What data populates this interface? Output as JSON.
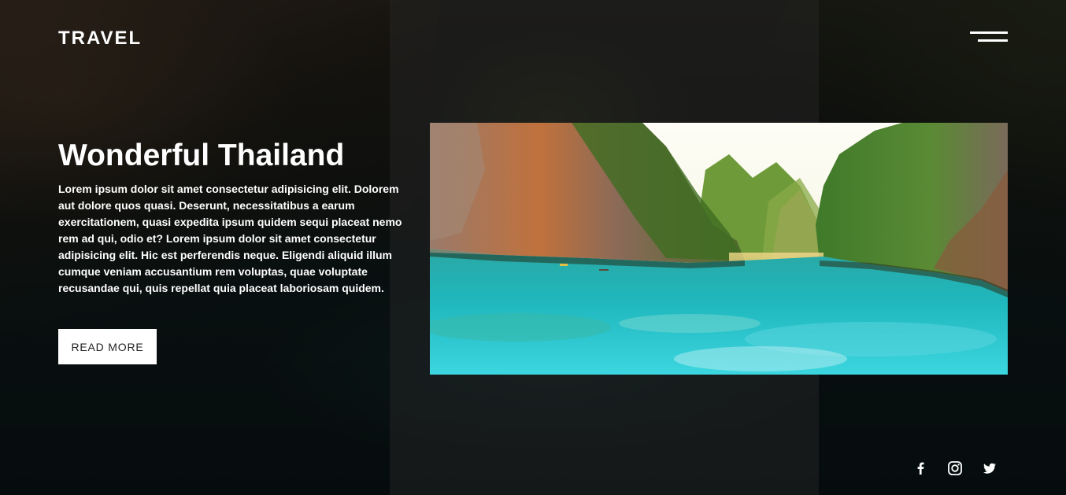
{
  "header": {
    "logo": "TRAVEL",
    "menu_icon": "hamburger-menu-icon"
  },
  "hero": {
    "title": "Wonderful Thailand",
    "description": "Lorem ipsum dolor sit amet consectetur adipisicing elit. Dolorem aut dolore quos quasi. Deserunt, necessitatibus a earum exercitationem, quasi expedita ipsum quidem sequi placeat nemo rem ad qui, odio et? Lorem ipsum dolor sit amet consectetur adipisicing elit. Hic est perferendis neque. Eligendi aliquid illum cumque veniam accusantium rem voluptas, quae voluptate recusandae qui, quis repellat quia placeat laboriosam quidem.",
    "button_label": "READ MORE",
    "image_icon": "thailand-lagoon-image"
  },
  "social": [
    {
      "icon": "facebook-icon"
    },
    {
      "icon": "instagram-icon"
    },
    {
      "icon": "twitter-icon"
    }
  ],
  "colors": {
    "text": "#ffffff",
    "button_bg": "#ffffff",
    "button_text": "#222222",
    "water": "#1fb7bd"
  }
}
